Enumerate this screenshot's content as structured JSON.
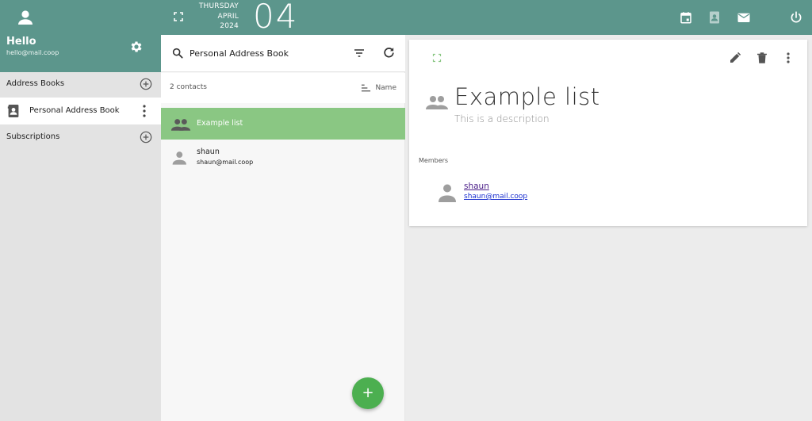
{
  "user": {
    "greeting": "Hello",
    "email": "hello@mail.coop"
  },
  "date": {
    "weekday": "THURSDAY",
    "month": "APRIL",
    "year": "2024",
    "day": "04"
  },
  "sidebar": {
    "address_books_label": "Address Books",
    "books": [
      {
        "label": "Personal Address Book"
      }
    ],
    "subscriptions_label": "Subscriptions"
  },
  "list": {
    "search_value": "Personal Address Book",
    "count_label": "2 contacts",
    "sort_label": "Name",
    "items": [
      {
        "title": "Example list",
        "type": "list",
        "selected": true
      },
      {
        "name": "shaun",
        "email": "shaun@mail.coop",
        "type": "contact",
        "selected": false
      }
    ],
    "fab_label": "+"
  },
  "detail": {
    "title": "Example list",
    "description": "This is a description",
    "members_label": "Members",
    "members": [
      {
        "name": "shaun",
        "email": "shaun@mail.coop"
      }
    ]
  },
  "icons": {
    "fullscreen": "fullscreen-icon",
    "calendar": "calendar-icon",
    "contacts": "contacts-icon",
    "mail": "mail-icon",
    "power": "power-icon",
    "settings": "gear-icon",
    "search": "search-icon",
    "filter": "filter-icon",
    "refresh": "refresh-icon",
    "sort": "sort-icon",
    "edit": "pencil-icon",
    "delete": "trash-icon",
    "more": "more-vert-icon",
    "group": "group-icon",
    "person": "person-icon"
  },
  "colors": {
    "header_teal": "#5c968c",
    "selected_green": "#8ac783",
    "fab_green": "#4caf50"
  }
}
